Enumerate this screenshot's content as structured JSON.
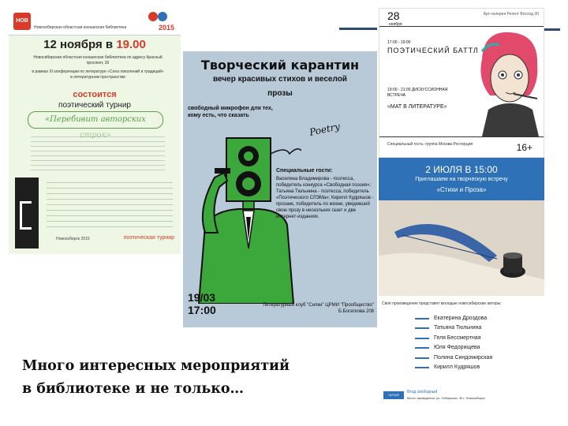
{
  "caption": {
    "line1": "Много интересных мероприятий",
    "line2": "в библиотеке и не только…"
  },
  "poster1": {
    "logo": "НОВ",
    "org": "Новосибирская областная юношеская библиотека",
    "year": "2015",
    "date_day": "12 ноября в ",
    "date_time": "19.00",
    "address": "Новосибирская областная юношеская библиотека по адресу Красный проспект, 26",
    "project": "в рамках XI конференции по литературе «Союз поколений и традиций» в литературном пространстве",
    "soon": "состоится",
    "turnir": "поэтический турнир",
    "fancy": "«Перебивит авторских строк»",
    "footer_city": "Новосибирск 2015",
    "footer_logo": "поэтическая турнир"
  },
  "poster2": {
    "title": "Творческий карантин",
    "subtitle1": "вечер красивых стихов и веселой",
    "subtitle2": "прозы",
    "mic": "свободный микрофон для тех, кому есть, что сказать",
    "poetry": "Poetry",
    "guests_heading": "Специальные гости:",
    "guests": "Василина Владимирова - поэтесса, победитель конкурса «Свободная поэзия»; Татьяна Тюльнина - поэтесса, победитель «Поэтического СЛЭМа»; Кирилл Кудряшов - прозаик, победитель по жизни, увидевший свою прозу в нескольких газет и две интернет-изданиях.",
    "date": "19/03",
    "time": "17:00",
    "club": "Литературный клуб \"Силки\" ЦРМИ \"Прообщество\" Б.Богаткова 208"
  },
  "poster3": {
    "day": "28",
    "month": "ноября",
    "venue": "Арт-галерея Регент Восход 30",
    "time1": "17:00 - 19:00",
    "battle": "ПОЭТИЧЕСКИЙ БАТТЛ",
    "meet": "19:00 - 21:00 ДИСКУССИОННАЯ ВСТРЕЧА",
    "meet_title": "«МАТ В ЛИТЕРАТУРЕ»",
    "bottom": "Специальный гость: группа Москва-Ростерция",
    "age": "16+"
  },
  "poster4": {
    "when": "2 ИЮЛЯ В 15:00",
    "invite": "Приглашаем на творческую встречу",
    "meeting": "«Стихи и Проза»"
  },
  "poster5": {
    "intro": "Своё произведение представят молодые новосибирские авторы:",
    "authors": [
      "Екатерина Дроздова",
      "Татьяна Тюльнина",
      "Геля Бессмертная",
      "Юля Федорищева",
      "Полина Синдомирская",
      "Кирилл Кудряшов"
    ],
    "logo": "ЧИТАЙ ГОРОД",
    "logo2": "Вход свободный",
    "footer": "Место проведения: ул. Сибирская, 30 г. Новосибирск"
  },
  "colors": {
    "accent_red": "#d93b2b",
    "green_suit": "#3ca83c",
    "blue_band": "#2e71b7",
    "deco_lines": "#2f4a73"
  }
}
